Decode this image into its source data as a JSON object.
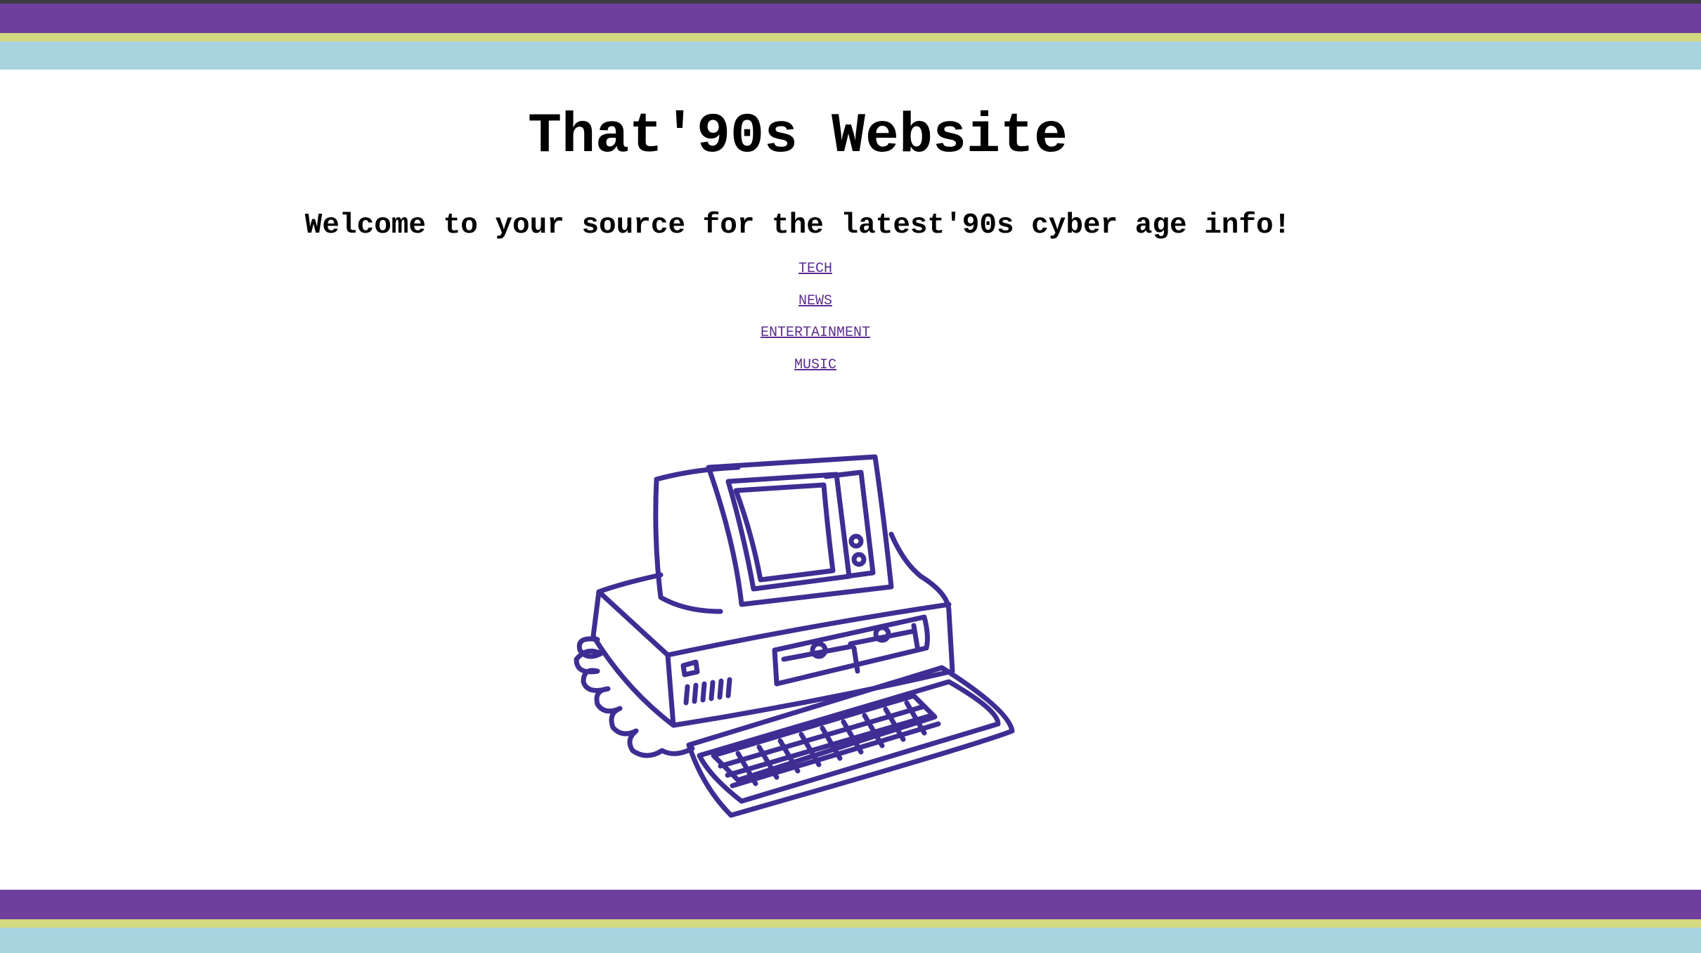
{
  "header": {
    "title": "That'90s Website",
    "subtitle": "Welcome to your source for the latest'90s cyber age info!"
  },
  "nav": {
    "items": [
      {
        "label": "TECH"
      },
      {
        "label": "NEWS"
      },
      {
        "label": "ENTERTAINMENT"
      },
      {
        "label": "MUSIC"
      }
    ]
  },
  "illustration": {
    "icon": "retro-computer-icon"
  },
  "colors": {
    "band_purple": "#6e3f9c",
    "band_lime": "#d3d97f",
    "band_blue": "#a8d4e0",
    "link": "#5b2d8e",
    "illustration_stroke": "#3f2d93"
  }
}
